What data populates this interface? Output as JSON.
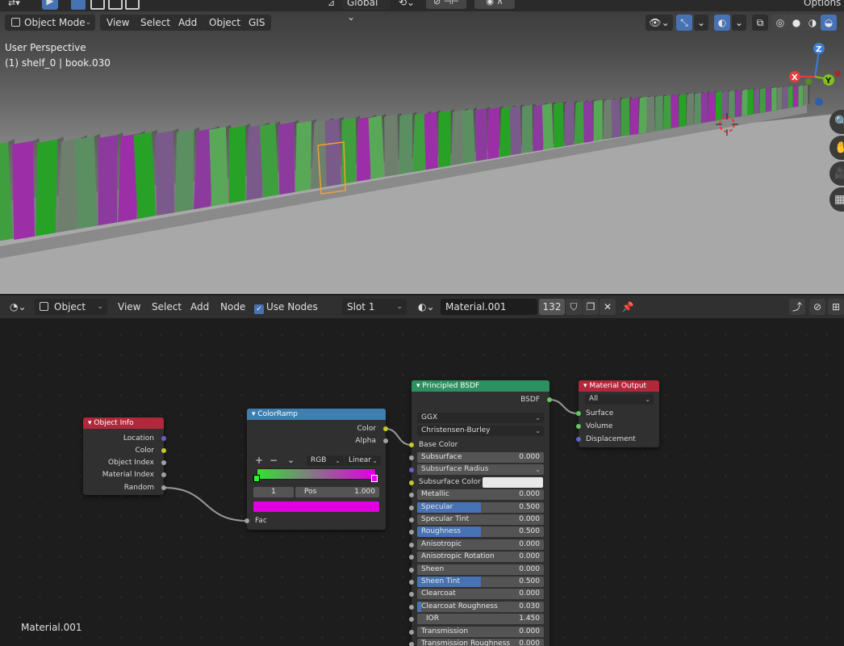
{
  "viewport": {
    "mode_label": "Object Mode",
    "menu": [
      "View",
      "Select",
      "Add",
      "Object",
      "GIS"
    ],
    "orientation_label": "Global",
    "options_label": "Options",
    "view_name": "User Perspective",
    "context": "(1) shelf_0 | book.030",
    "axes": {
      "x": "X",
      "y": "Y",
      "z": "Z"
    },
    "icons": [
      "visibility-icon",
      "gizmo-icon",
      "overlay-icon",
      "xray-icon",
      "shading-icons",
      "zoom-icon",
      "hand-icon",
      "camera-icon",
      "grid-icon"
    ],
    "book_colors": [
      "#3f9f3f",
      "#58a858",
      "#7a5a8a",
      "#8c3a9e",
      "#27a227",
      "#5b8f62",
      "#9c2ea8",
      "#6e7f6e"
    ]
  },
  "node_editor": {
    "editor_type": "Object",
    "menu": [
      "View",
      "Select",
      "Add",
      "Node"
    ],
    "use_nodes_label": "Use Nodes",
    "use_nodes_checked": true,
    "slot": "Slot 1",
    "material_name": "Material.001",
    "user_count": "132",
    "corner_label": "Material.001"
  },
  "nodes": {
    "object_info": {
      "title": "Object Info",
      "color": "#b3273a",
      "outputs": [
        "Location",
        "Color",
        "Object Index",
        "Material Index",
        "Random"
      ]
    },
    "color_ramp": {
      "title": "ColorRamp",
      "color": "#3f7fb0",
      "outputs": [
        "Color",
        "Alpha"
      ],
      "controls": {
        "add": "+",
        "remove": "−",
        "more": "⌄",
        "mode": "RGB",
        "interpolation": "Linear"
      },
      "stop_index": "1",
      "pos_label": "Pos",
      "pos_value": "1.000",
      "stop_color": "#e000e0",
      "ramp_start": "#33e033",
      "ramp_end": "#e000e0",
      "input": "Fac"
    },
    "principled": {
      "title": "Principled BSDF",
      "color": "#2d9060",
      "output": "BSDF",
      "distribution": "GGX",
      "subsurface_method": "Christensen-Burley",
      "base_color_label": "Base Color",
      "params": [
        {
          "name": "Subsurface",
          "value": "0.000",
          "fill": 0
        },
        {
          "name": "Subsurface Radius",
          "value": "",
          "fill": 0,
          "dropdown": true
        },
        {
          "name": "Subsurface Color",
          "value": "",
          "fill": 0,
          "swatch": "#e8e8e8"
        },
        {
          "name": "Metallic",
          "value": "0.000",
          "fill": 0
        },
        {
          "name": "Specular",
          "value": "0.500",
          "fill": 0.5
        },
        {
          "name": "Specular Tint",
          "value": "0.000",
          "fill": 0
        },
        {
          "name": "Roughness",
          "value": "0.500",
          "fill": 0.5
        },
        {
          "name": "Anisotropic",
          "value": "0.000",
          "fill": 0
        },
        {
          "name": "Anisotropic Rotation",
          "value": "0.000",
          "fill": 0
        },
        {
          "name": "Sheen",
          "value": "0.000",
          "fill": 0
        },
        {
          "name": "Sheen Tint",
          "value": "0.500",
          "fill": 0.5
        },
        {
          "name": "Clearcoat",
          "value": "0.000",
          "fill": 0
        },
        {
          "name": "Clearcoat Roughness",
          "value": "0.030",
          "fill": 0.03
        },
        {
          "name": "IOR",
          "value": "1.450",
          "fill": 0
        },
        {
          "name": "Transmission",
          "value": "0.000",
          "fill": 0
        },
        {
          "name": "Transmission Roughness",
          "value": "0.000",
          "fill": 0
        }
      ]
    },
    "material_output": {
      "title": "Material Output",
      "color": "#b3273a",
      "target": "All",
      "inputs": [
        "Surface",
        "Volume",
        "Displacement"
      ]
    }
  }
}
